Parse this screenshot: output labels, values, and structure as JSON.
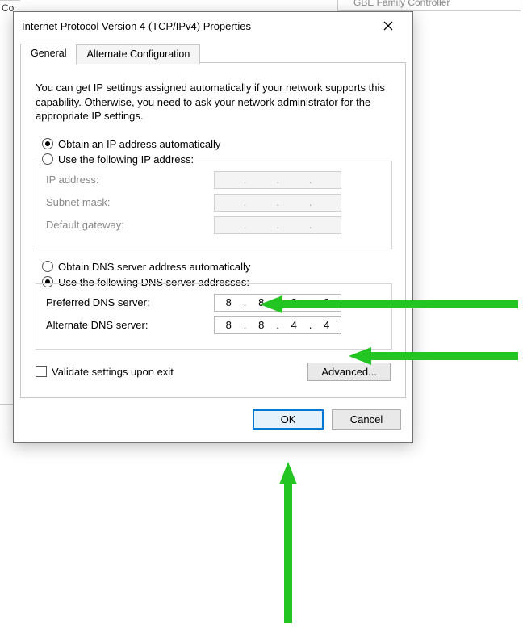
{
  "background": {
    "top_text_frag": "GBE Family Controller",
    "co_label": "Co"
  },
  "dialog": {
    "title": "Internet Protocol Version 4 (TCP/IPv4) Properties",
    "tabs": {
      "general": "General",
      "alt": "Alternate Configuration"
    },
    "intro": "You can get IP settings assigned automatically if your network supports this capability. Otherwise, you need to ask your network administrator for the appropriate IP settings.",
    "ip_radio_auto": "Obtain an IP address automatically",
    "ip_radio_manual": "Use the following IP address:",
    "ip_fields": {
      "ip_label": "IP address:",
      "subnet_label": "Subnet mask:",
      "gateway_label": "Default gateway:"
    },
    "dns_radio_auto": "Obtain DNS server address automatically",
    "dns_radio_manual": "Use the following DNS server addresses:",
    "dns_fields": {
      "preferred_label": "Preferred DNS server:",
      "alternate_label": "Alternate DNS server:",
      "preferred": [
        "8",
        "8",
        "8",
        "8"
      ],
      "alternate": [
        "8",
        "8",
        "4",
        "4"
      ]
    },
    "validate_label": "Validate settings upon exit",
    "advanced_btn": "Advanced...",
    "ok_btn": "OK",
    "cancel_btn": "Cancel"
  }
}
